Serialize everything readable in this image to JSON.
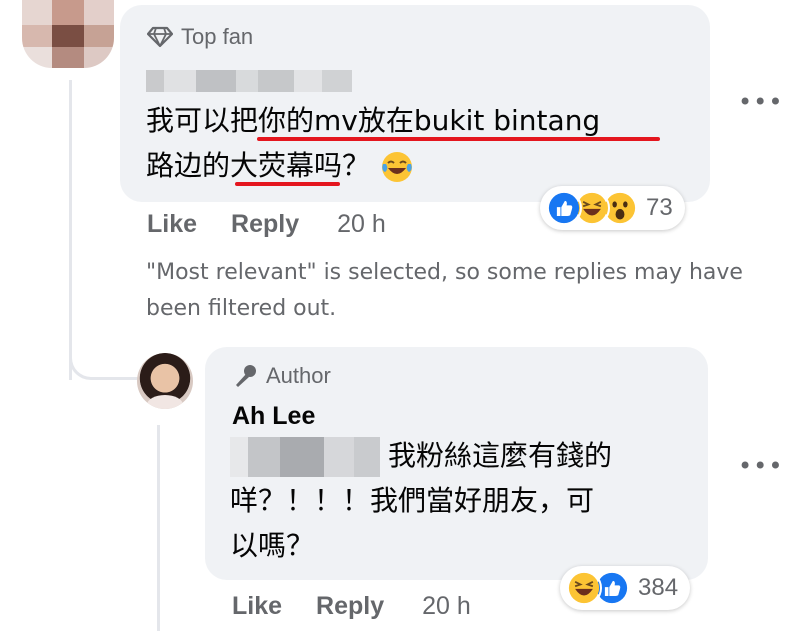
{
  "comment": {
    "badge": "Top fan",
    "lines": [
      {
        "plain1": "我可以",
        "under": "把你的mv放在bukit bintang",
        "plain2": ""
      },
      {
        "plain1": "路边的",
        "under": "大荧幕",
        "plain2": "吗？"
      }
    ],
    "reactions": {
      "icons": [
        "like-icon",
        "laugh-icon",
        "wow-icon"
      ],
      "count": "73"
    },
    "actions": {
      "like": "Like",
      "reply": "Reply",
      "time": "20 h"
    }
  },
  "notice": "\"Most relevant\" is selected, so some replies may have been filtered out.",
  "reply": {
    "badge": "Author",
    "author": "Ah Lee",
    "lines": [
      "我粉絲這麼有錢的",
      "咩？！！！我們當好朋友，可",
      "以嗎？"
    ],
    "reactions": {
      "icons": [
        "laugh-icon",
        "like-icon"
      ],
      "count": "384"
    },
    "actions": {
      "like": "Like",
      "reply": "Reply",
      "time": "20 h"
    }
  },
  "colors": {
    "bubble": "#f0f2f5",
    "meta": "#65676b",
    "underline": "#e4161e",
    "like_blue": "#1877f2",
    "emoji_yellow": "#fcc434"
  }
}
